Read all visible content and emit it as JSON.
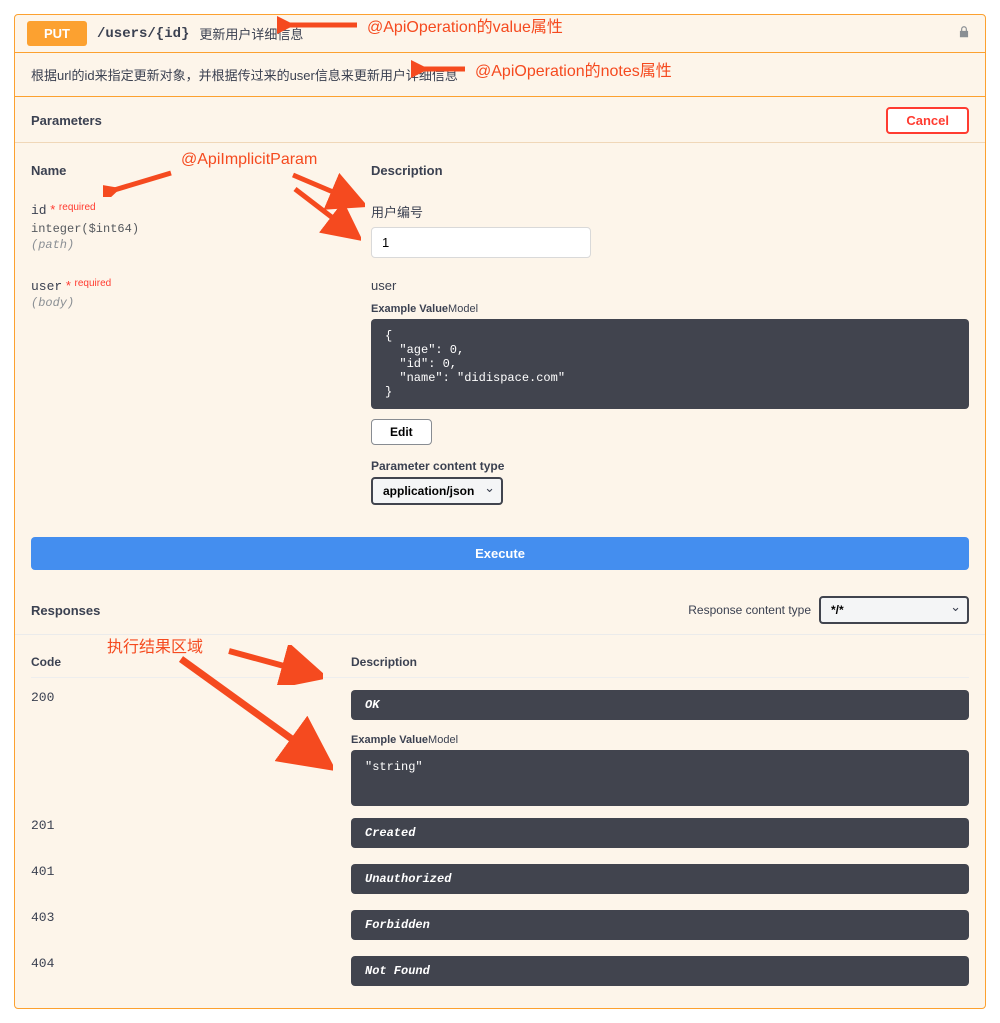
{
  "method": "PUT",
  "path": "/users/{id}",
  "summary": "更新用户详细信息",
  "notes": "根据url的id来指定更新对象，并根据传过来的user信息来更新用户详细信息",
  "annotations": {
    "value_attr": "@ApiOperation的value属性",
    "notes_attr": "@ApiOperation的notes属性",
    "implicit_param": "@ApiImplicitParam",
    "result_area": "执行结果区域"
  },
  "sections": {
    "parameters_title": "Parameters",
    "cancel": "Cancel",
    "name_col": "Name",
    "desc_col": "Description",
    "responses_title": "Responses",
    "response_content_type_label": "Response content type",
    "code_col": "Code"
  },
  "parameters": [
    {
      "name": "id",
      "required": "required",
      "type": "integer($int64)",
      "in": "(path)",
      "description": "用户编号",
      "value": "1"
    },
    {
      "name": "user",
      "required": "required",
      "in": "(body)",
      "description": "user",
      "example_label_bold": "Example Value",
      "example_label_normal": "Model",
      "example_value": "{\n  \"age\": 0,\n  \"id\": 0,\n  \"name\": \"didispace.com\"\n}",
      "edit_label": "Edit",
      "content_type_label": "Parameter content type",
      "content_type_value": "application/json"
    }
  ],
  "execute_label": "Execute",
  "response_content_type_value": "*/*",
  "responses": [
    {
      "code": "200",
      "desc": "OK",
      "example_label_bold": "Example Value",
      "example_label_normal": "Model",
      "example_value": "\"string\""
    },
    {
      "code": "201",
      "desc": "Created"
    },
    {
      "code": "401",
      "desc": "Unauthorized"
    },
    {
      "code": "403",
      "desc": "Forbidden"
    },
    {
      "code": "404",
      "desc": "Not Found"
    }
  ]
}
